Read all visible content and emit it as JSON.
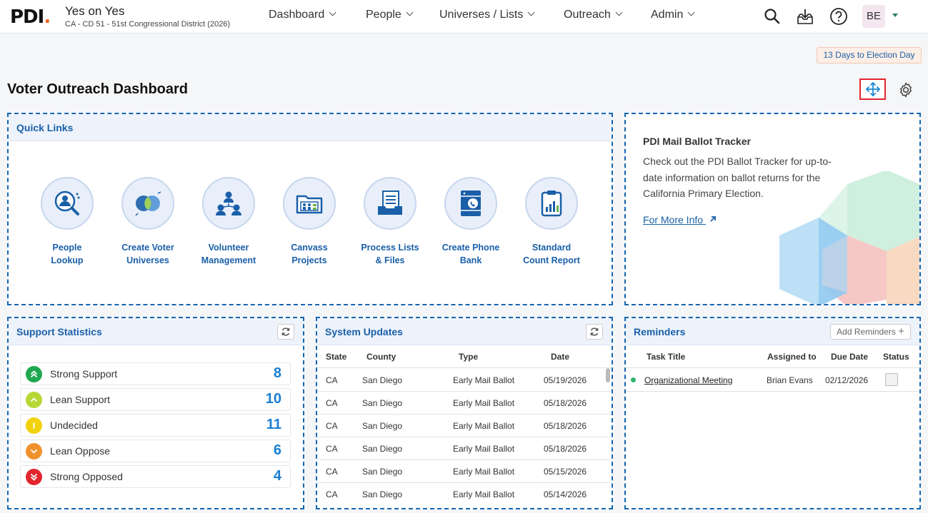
{
  "header": {
    "logo_text": "PDI",
    "org_name": "Yes on Yes",
    "org_sub": "CA - CD 51 - 51st Congressional District (2026)",
    "nav": [
      "Dashboard",
      "People",
      "Universes / Lists",
      "Outreach",
      "Admin"
    ],
    "icons": [
      "search-icon",
      "download-tray-icon",
      "help-icon"
    ],
    "avatar_initials": "BE"
  },
  "election_badge": "13 Days to Election Day",
  "page_title": "Voter Outreach Dashboard",
  "colors": {
    "accent": "#1a5fa8",
    "brand_orange": "#f26522",
    "highlight_border": "#e0262c"
  },
  "quick_links": {
    "title": "Quick Links",
    "items": [
      {
        "line1": "People",
        "line2": "Lookup",
        "icon": "people-lookup-icon"
      },
      {
        "line1": "Create Voter",
        "line2": "Universes",
        "icon": "venn-universe-icon"
      },
      {
        "line1": "Volunteer",
        "line2": "Management",
        "icon": "volunteers-icon"
      },
      {
        "line1": "Canvass",
        "line2": "Projects",
        "icon": "canvass-folder-icon"
      },
      {
        "line1": "Process Lists",
        "line2": "& Files",
        "icon": "file-tray-icon"
      },
      {
        "line1": "Create Phone",
        "line2": "Bank",
        "icon": "phone-bank-icon"
      },
      {
        "line1": "Standard",
        "line2": "Count Report",
        "icon": "report-clipboard-icon"
      }
    ]
  },
  "ballot_tracker": {
    "title": "PDI Mail Ballot Tracker",
    "body": "Check out the PDI Ballot Tracker for up-to-date information on ballot returns for the California Primary Election.",
    "link": "For More Info"
  },
  "support_stats": {
    "title": "Support Statistics",
    "rows": [
      {
        "label": "Strong Support",
        "value": "8",
        "color": "#1fa850"
      },
      {
        "label": "Lean Support",
        "value": "10",
        "color": "#b5d836"
      },
      {
        "label": "Undecided",
        "value": "11",
        "color": "#f2d20c"
      },
      {
        "label": "Lean Oppose",
        "value": "6",
        "color": "#f0922c"
      },
      {
        "label": "Strong Opposed",
        "value": "4",
        "color": "#e2262e"
      }
    ]
  },
  "system_updates": {
    "title": "System Updates",
    "columns": [
      "State",
      "County",
      "Type",
      "Date"
    ],
    "rows": [
      [
        "CA",
        "San Diego",
        "Early Mail Ballot",
        "05/19/2026"
      ],
      [
        "CA",
        "San Diego",
        "Early Mail Ballot",
        "05/18/2026"
      ],
      [
        "CA",
        "San Diego",
        "Early Mail Ballot",
        "05/18/2026"
      ],
      [
        "CA",
        "San Diego",
        "Early Mail Ballot",
        "05/18/2026"
      ],
      [
        "CA",
        "San Diego",
        "Early Mail Ballot",
        "05/15/2026"
      ],
      [
        "CA",
        "San Diego",
        "Early Mail Ballot",
        "05/14/2026"
      ]
    ]
  },
  "reminders": {
    "title": "Reminders",
    "add_label": "Add Reminders",
    "columns": [
      "Task Title",
      "Assigned to",
      "Due Date",
      "Status"
    ],
    "rows": [
      {
        "title": "Organizational Meeting",
        "assigned": "Brian Evans",
        "due": "02/12/2026"
      }
    ]
  }
}
